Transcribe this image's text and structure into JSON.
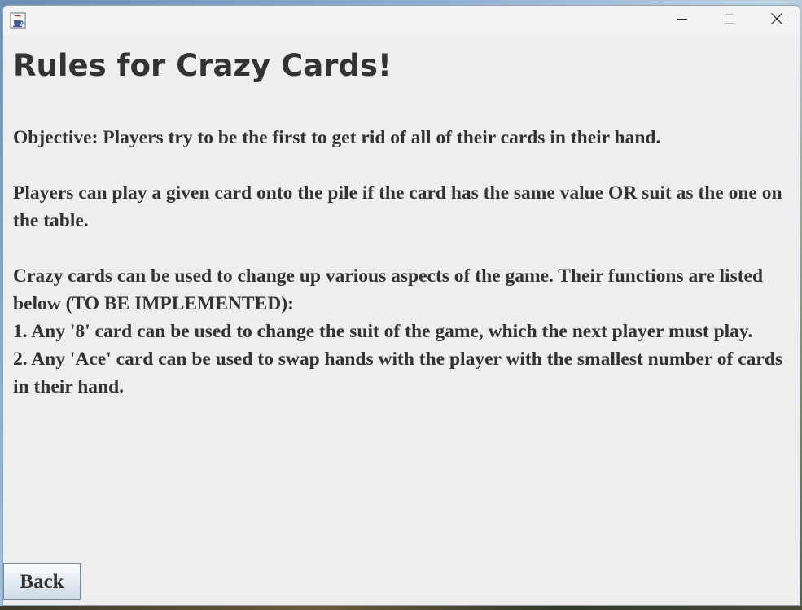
{
  "window": {
    "app_icon": "java-cup-icon",
    "controls": {
      "minimize": "minimize-icon",
      "maximize": "maximize-icon",
      "close": "close-icon"
    }
  },
  "heading": "Rules for Crazy Cards!",
  "rules": {
    "objective": "Objective: Players try to be the first to get rid of all of their cards in their hand.",
    "play_rule": "Players can play a given card onto the pile if the card has the same value OR suit as the one on the table.",
    "crazy_intro": "Crazy cards can be used to change up various aspects of the game. Their functions are listed below (TO BE IMPLEMENTED):",
    "items": [
      "1. Any '8' card can be used to change the suit of the game, which the next player must play.",
      "2. Any 'Ace' card can be used to swap hands with the player with the smallest number of cards in their hand."
    ]
  },
  "back_label": "Back"
}
